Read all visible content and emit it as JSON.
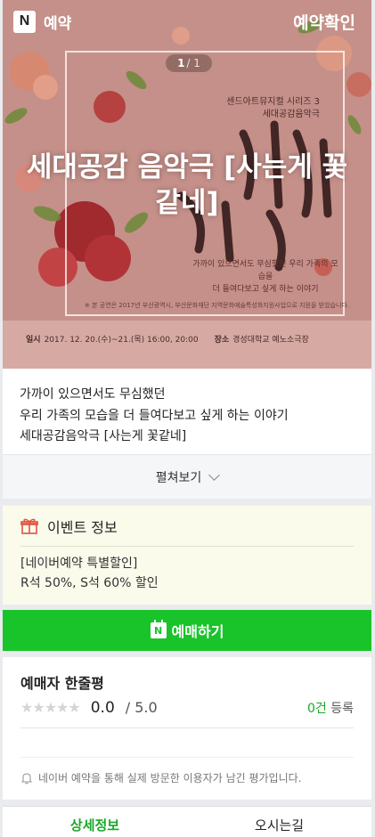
{
  "header": {
    "logo_letter": "N",
    "service_label": "예약",
    "confirm_label": "예약확인"
  },
  "carousel": {
    "current": "1",
    "total": "/ 1"
  },
  "poster": {
    "series_line1": "센드아트뮤지컬 시리즈 3",
    "series_line2": "세대공감음악극",
    "subtitle_line1": "가까이 있으면서도 무심했던 우리 가족의 모습을",
    "subtitle_line2": "더 들여다보고 싶게 하는 이야기",
    "note": "※ 본 공연은 2017년 부산광역시, 부산문화재단 지역문화예술특성화지원사업으로 지원을 받았습니다.",
    "date_label": "일시",
    "date_value": "2017. 12. 20.(수)~21.(목) 16:00, 20:00",
    "venue_label": "장소",
    "venue_value": "경성대학교 예노소극장"
  },
  "title": "세대공감 음악극 [사는게 꽃같네]",
  "description": {
    "line1": "가까이 있으면서도 무심했던",
    "line2": "우리 가족의 모습을 더 들여다보고 싶게 하는 이야기",
    "line3": "세대공감음악극 [사는게 꽃같네]"
  },
  "expand_label": "펼쳐보기",
  "event": {
    "heading": "이벤트 정보",
    "line1": "[네이버예약 특별할인]",
    "line2": "R석 50%, S석 60% 할인"
  },
  "book_label": "예매하기",
  "review": {
    "heading": "예매자 한줄평",
    "stars": "★★★★★",
    "score": "0.0",
    "max": "/ 5.0",
    "count": "0건",
    "count_suffix": "등록",
    "notice": "네이버 예약을 통해 실제 방문한 이용자가 남긴 평가입니다."
  },
  "tabs": [
    {
      "label": "상세정보"
    },
    {
      "label": "오시는길"
    }
  ],
  "colors": {
    "brand_green": "#19c32a",
    "poster_bg": "#c48e86"
  }
}
